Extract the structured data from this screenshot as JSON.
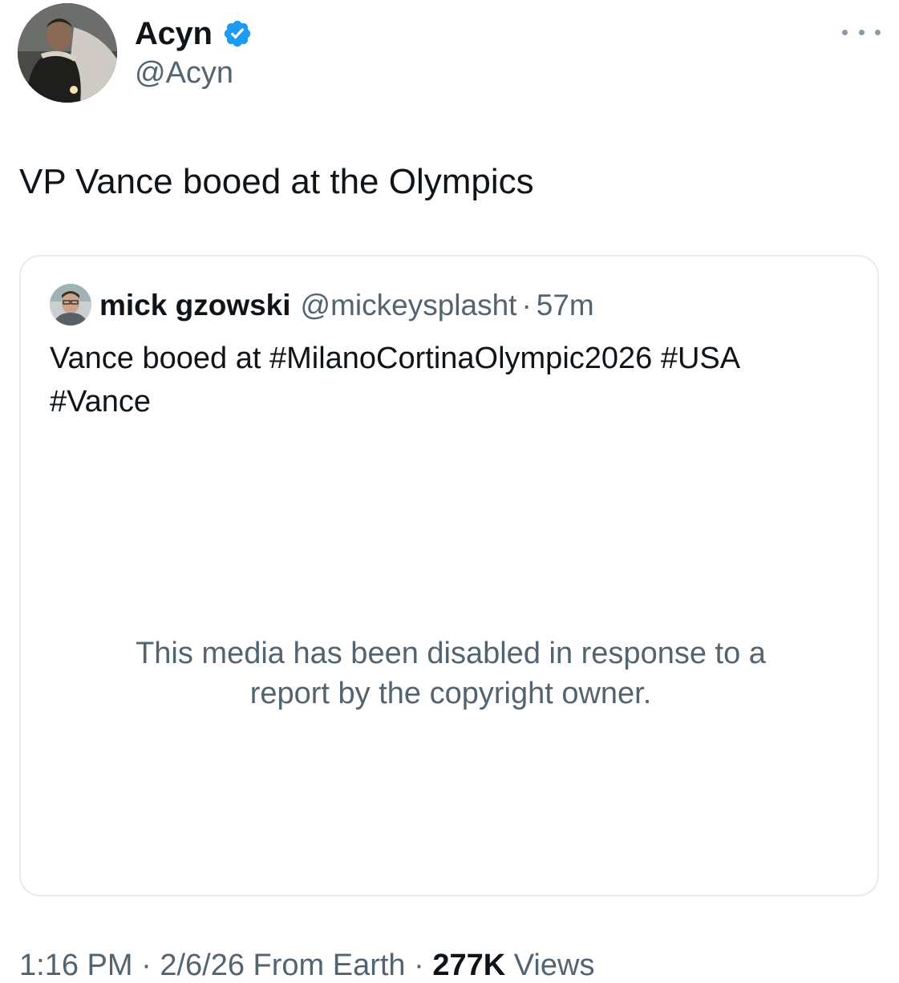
{
  "tweet": {
    "author": {
      "name": "Acyn",
      "handle": "@Acyn",
      "verified": true
    },
    "text": "VP Vance booed at the Olympics",
    "quoted": {
      "name": "mick gzowski",
      "handle": "@mickeysplasht",
      "separator": "·",
      "time": "57m",
      "text_line1": "Vance booed at #MilanoCortinaOlympic2026 #USA",
      "text_line2": "#Vance",
      "media_notice_line1": "This media has been disabled in response to a",
      "media_notice_line2": "report by the copyright owner."
    },
    "meta": {
      "time": "1:16 PM",
      "sep1": "·",
      "date": "2/6/26",
      "source": "From Earth",
      "sep2": "·",
      "views_count": "277K",
      "views_label": "Views"
    }
  },
  "colors": {
    "text_primary": "#0f1419",
    "text_secondary": "#536471",
    "verified_badge": "#1d9bf0",
    "card_border": "#e6ebef"
  },
  "icons": {
    "verified": "verified-badge-icon",
    "more": "more-options-icon"
  }
}
